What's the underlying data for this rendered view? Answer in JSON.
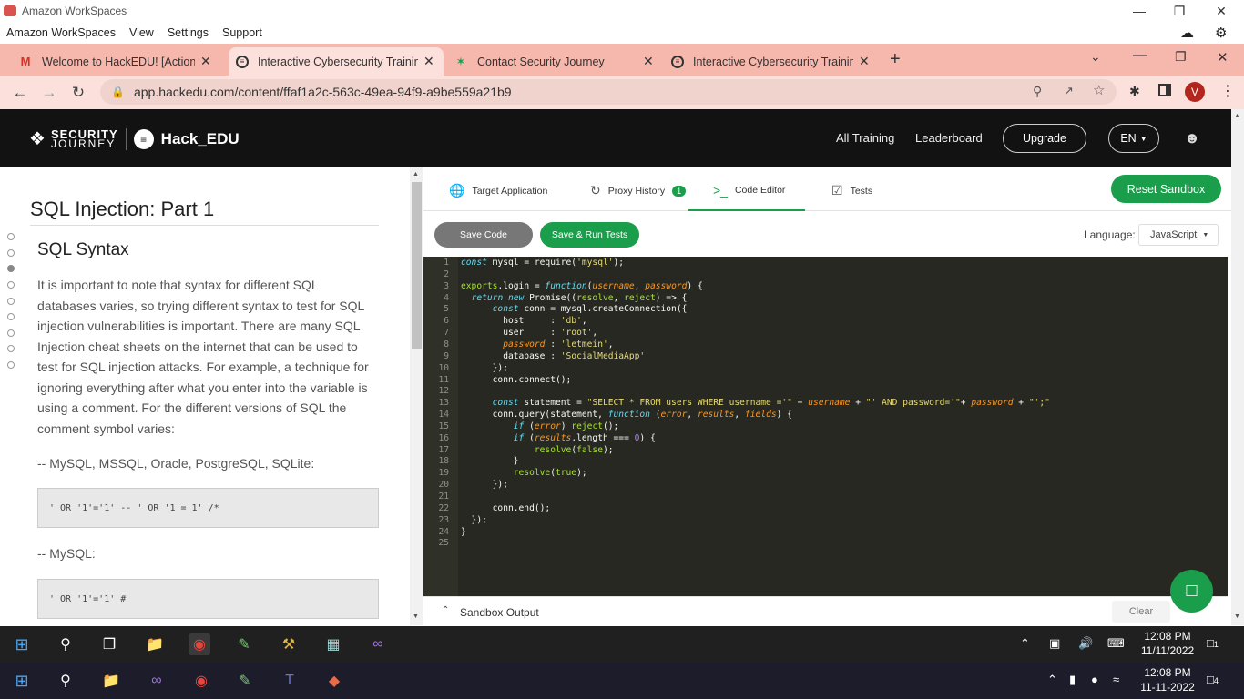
{
  "workspaces": {
    "title": "Amazon WorkSpaces",
    "menu": [
      "Amazon WorkSpaces",
      "View",
      "Settings",
      "Support"
    ]
  },
  "browser": {
    "tabs": [
      {
        "label": "Welcome to HackEDU! [Action Re",
        "icon": "gmail-icon"
      },
      {
        "label": "Interactive Cybersecurity Training",
        "icon": "hackedu-icon",
        "active": true
      },
      {
        "label": "Contact Security Journey",
        "icon": "security-journey-icon"
      },
      {
        "label": "Interactive Cybersecurity Training",
        "icon": "hackedu-icon"
      }
    ],
    "url": "app.hackedu.com/content/ffaf1a2c-563c-49ea-94f9-a9be559a21b9",
    "profile_initial": "V"
  },
  "app": {
    "brand_top": "SECURITY",
    "brand_bottom": "JOURNEY",
    "brand_product": "Hack_EDU",
    "nav": {
      "training": "All Training",
      "leaderboard": "Leaderboard",
      "upgrade": "Upgrade",
      "lang": "EN"
    }
  },
  "lesson": {
    "title": "SQL Injection: Part 1",
    "section": "SQL Syntax",
    "paragraph": "It is important to note that syntax for different SQL databases varies, so trying different syntax to test for SQL injection vulnerabilities is important. There are many SQL Injection cheat sheets on the internet that can be used to test for SQL injection attacks. For example, a technique for ignoring everything after what you enter into the variable is using a comment. For the different versions of SQL the comment symbol varies:",
    "sub1": "-- MySQL, MSSQL, Oracle, PostgreSQL, SQLite:",
    "code1": "' OR '1'='1' -- ' OR '1'='1' /*",
    "sub2": "-- MySQL:",
    "code2": "' OR '1'='1' #"
  },
  "sandbox": {
    "tabs": {
      "target": "Target Application",
      "proxy": "Proxy History",
      "proxy_count": "1",
      "code": "Code Editor",
      "tests": "Tests"
    },
    "reset": "Reset Sandbox",
    "save": "Save Code",
    "save_run": "Save & Run Tests",
    "language_label": "Language:",
    "language": "JavaScript",
    "output_label": "Sandbox Output",
    "clear": "Clear"
  },
  "code_lines": [
    "const mysql = require('mysql');",
    "",
    "exports.login = function(username, password) {",
    "  return new Promise((resolve, reject) => {",
    "      const conn = mysql.createConnection({",
    "        host     : 'db',",
    "        user     : 'root',",
    "        password : 'letmein',",
    "        database : 'SocialMediaApp'",
    "      });",
    "      conn.connect();",
    "",
    "      const statement = \"SELECT * FROM users WHERE username ='\" + username + \"' AND password='\"+ password + \"';\"",
    "      conn.query(statement, function (error, results, fields) {",
    "          if (error) reject();",
    "          if (results.length === 0) {",
    "              resolve(false);",
    "          }",
    "          resolve(true);",
    "      });",
    "",
    "      conn.end();",
    "  });",
    "}",
    ""
  ],
  "taskbar1": {
    "time": "12:08 PM",
    "date": "11/11/2022",
    "notif": "1"
  },
  "taskbar2": {
    "time": "12:08 PM",
    "date": "11-11-2022",
    "notif": "4"
  }
}
